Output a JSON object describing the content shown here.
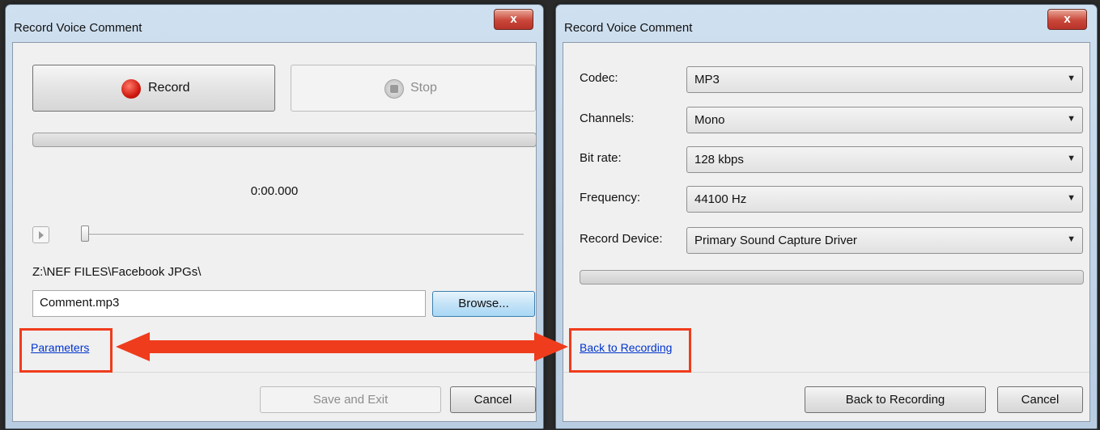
{
  "left_window": {
    "title": "Record Voice Comment",
    "close_label": "x",
    "record_label": "Record",
    "stop_label": "Stop",
    "time": "0:00.000",
    "folder_path": "Z:\\NEF FILES\\Facebook JPGs\\",
    "filename": "Comment.mp3",
    "browse_label": "Browse...",
    "parameters_link": "Parameters",
    "save_label": "Save and Exit",
    "cancel_label": "Cancel"
  },
  "right_window": {
    "title": "Record Voice Comment",
    "close_label": "x",
    "fields": [
      {
        "label": "Codec:",
        "value": "MP3"
      },
      {
        "label": "Channels:",
        "value": "Mono"
      },
      {
        "label": "Bit rate:",
        "value": "128 kbps"
      },
      {
        "label": "Frequency:",
        "value": "44100 Hz"
      },
      {
        "label": "Record Device:",
        "value": "Primary Sound Capture Driver"
      }
    ],
    "back_link": "Back to Recording",
    "back_button_label": "Back to Recording",
    "cancel_label": "Cancel"
  },
  "colors": {
    "highlight": "#ef3c1c",
    "link": "#0033cc"
  }
}
